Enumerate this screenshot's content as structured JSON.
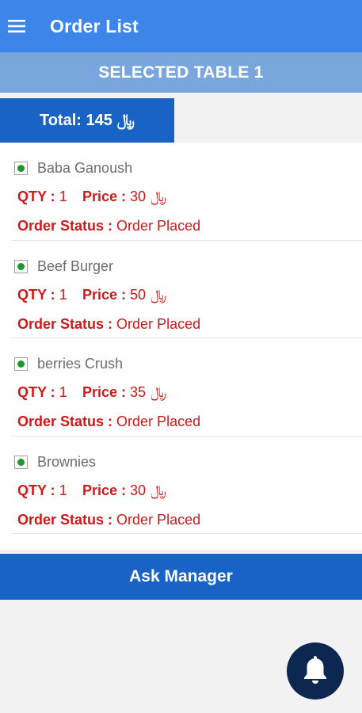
{
  "header": {
    "title": "Order List",
    "menu_icon": "hamburger-menu-icon"
  },
  "banner": {
    "text": "SELECTED TABLE 1"
  },
  "total": {
    "label": "Total: 145",
    "currency": "﷼"
  },
  "orders": [
    {
      "name": "Baba Ganoush",
      "qty_label": "QTY :",
      "qty": "1",
      "price_label": "Price :",
      "price": "30",
      "currency": "﷼",
      "status_label": "Order Status :",
      "status": "Order Placed"
    },
    {
      "name": "Beef Burger",
      "qty_label": "QTY :",
      "qty": "1",
      "price_label": "Price :",
      "price": "50",
      "currency": "﷼",
      "status_label": "Order Status :",
      "status": "Order Placed"
    },
    {
      "name": "berries Crush",
      "qty_label": "QTY :",
      "qty": "1",
      "price_label": "Price :",
      "price": "35",
      "currency": "﷼",
      "status_label": "Order Status :",
      "status": "Order Placed"
    },
    {
      "name": "Brownies",
      "qty_label": "QTY :",
      "qty": "1",
      "price_label": "Price :",
      "price": "30",
      "currency": "﷼",
      "status_label": "Order Status :",
      "status": "Order Placed"
    }
  ],
  "actions": {
    "ask_manager": "Ask Manager",
    "bell_icon": "bell-icon"
  },
  "colors": {
    "app_bar": "#3d85e8",
    "banner": "#78a6dd",
    "primary_dark": "#1a63c6",
    "accent_red": "#cc1a1a",
    "veg_green": "#1b9a2b",
    "fab": "#0c2851"
  }
}
